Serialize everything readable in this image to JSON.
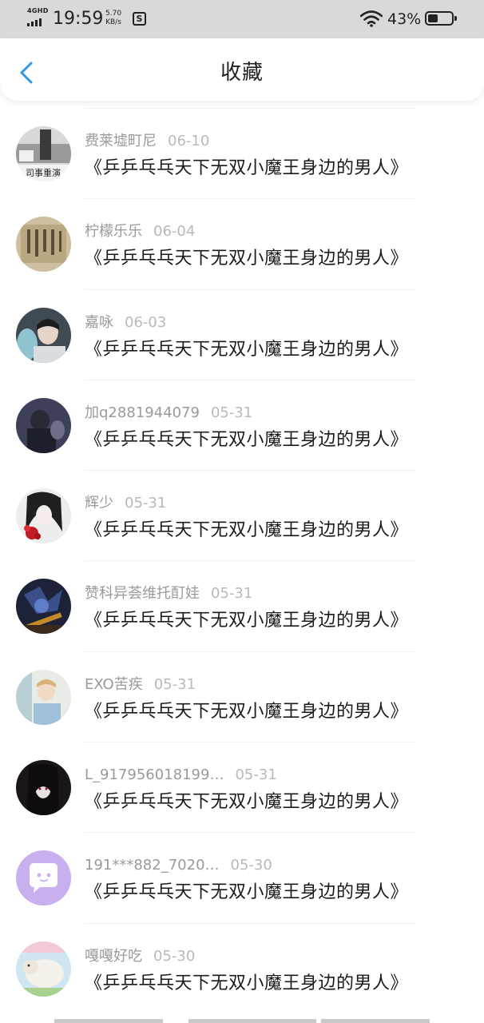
{
  "status_bar": {
    "network_type": "4GHD",
    "time": "19:59",
    "speed_value": "5.70",
    "speed_unit": "KB/s",
    "app_icon": "s-notification-icon",
    "battery_percent": "43%",
    "battery_level": 0.43
  },
  "header": {
    "back_icon": "chevron-left-icon",
    "title": "收藏",
    "accent_color": "#2f97e8"
  },
  "favorites": [
    {
      "name": "费莱墟町尼",
      "date": "06-10",
      "title": "《乒乒乓乓天下无双小魔王身边的男人》",
      "avatar_text": "司事重演"
    },
    {
      "name": "柠檬乐乐",
      "date": "06-04",
      "title": "《乒乒乓乓天下无双小魔王身边的男人》"
    },
    {
      "name": "嘉咏",
      "date": "06-03",
      "title": "《乒乒乓乓天下无双小魔王身边的男人》"
    },
    {
      "name": "加q2881944079",
      "date": "05-31",
      "title": "《乒乒乓乓天下无双小魔王身边的男人》"
    },
    {
      "name": "辉少",
      "date": "05-31",
      "title": "《乒乒乓乓天下无双小魔王身边的男人》"
    },
    {
      "name": "赞科异荟维托酊娃",
      "date": "05-31",
      "title": "《乒乒乓乓天下无双小魔王身边的男人》"
    },
    {
      "name": "EXO苦疾",
      "date": "05-31",
      "title": "《乒乒乓乓天下无双小魔王身边的男人》"
    },
    {
      "name": "L_917956018199…",
      "date": "05-31",
      "title": "《乒乒乓乓天下无双小魔王身边的男人》"
    },
    {
      "name": "191***882_7020…",
      "date": "05-30",
      "title": "《乒乒乓乓天下无双小魔王身边的男人》"
    },
    {
      "name": "嘎嘎好吃",
      "date": "05-30",
      "title": "《乒乒乓乓天下无双小魔王身边的男人》"
    }
  ]
}
